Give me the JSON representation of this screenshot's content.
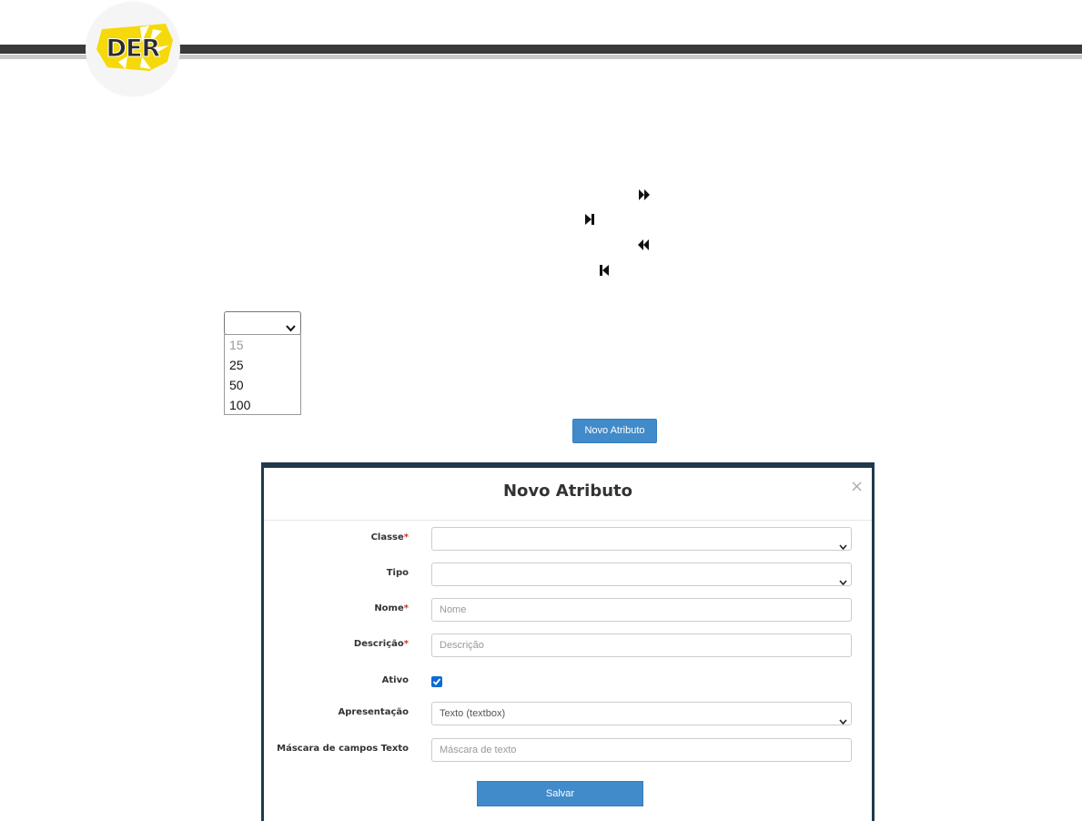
{
  "header": {
    "logo_text": "DER",
    "colors": {
      "bar_dark": "#3a3a3a",
      "bar_light": "#c9c9c9",
      "logo_yellow": "#f5d90a"
    }
  },
  "pager": {
    "icons": [
      "fast-forward-icon",
      "last-page-icon",
      "rewind-icon",
      "first-page-icon"
    ]
  },
  "page_size": {
    "selected": "",
    "options": [
      {
        "label": "15",
        "disabled": true
      },
      {
        "label": "25",
        "disabled": false
      },
      {
        "label": "50",
        "disabled": false
      },
      {
        "label": "100",
        "disabled": false
      }
    ]
  },
  "toolbar": {
    "novo_atributo_label": "Novo Atributo"
  },
  "modal": {
    "title": "Novo Atributo",
    "close_label": "×",
    "fields": {
      "classe": {
        "label": "Classe",
        "required_mark": "*",
        "value": ""
      },
      "tipo": {
        "label": "Tipo",
        "value": ""
      },
      "nome": {
        "label": "Nome",
        "required_mark": "*",
        "placeholder": "Nome"
      },
      "descricao": {
        "label": "Descrição",
        "required_mark": "*",
        "placeholder": "Descrição"
      },
      "ativo": {
        "label": "Ativo",
        "checked": true
      },
      "apresentacao": {
        "label": "Apresentação",
        "value": "Texto (textbox)"
      },
      "mascara": {
        "label": "Máscara de campos Texto",
        "placeholder": "Máscara de texto"
      }
    },
    "save_label": "Salvar"
  },
  "colors": {
    "primary_button": "#428bca",
    "required": "#c0392b",
    "checkbox": "#0b6bd3"
  }
}
